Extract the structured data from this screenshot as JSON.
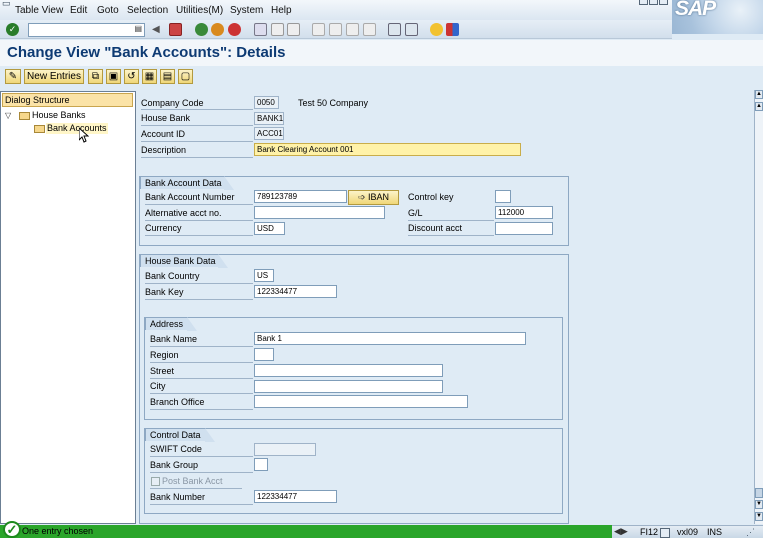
{
  "menu": {
    "table_view": "Table View",
    "edit": "Edit",
    "goto": "Goto",
    "selection": "Selection",
    "utilities": "Utilities(M)",
    "system": "System",
    "help": "Help"
  },
  "brand": {
    "logo": "SAP",
    "accent": "#0d3a73",
    "status_green": "#2aa52a",
    "highlight_yellow": "#fff2a8"
  },
  "command": {
    "value": ""
  },
  "page": {
    "title": "Change View \"Bank Accounts\": Details"
  },
  "toolbar2": {
    "new_entries": "New Entries"
  },
  "tree": {
    "header": "Dialog Structure",
    "node": "House Banks",
    "child": "Bank Accounts"
  },
  "fields": {
    "company_code_label": "Company Code",
    "company_code": "0050",
    "company_name": "Test 50 Company",
    "house_bank_label": "House Bank",
    "house_bank": "BANK1",
    "account_id_label": "Account ID",
    "account_id": "ACC01",
    "description_label": "Description",
    "description": "Bank Clearing Account 001"
  },
  "bank_account_data": {
    "title": "Bank Account Data",
    "account_number_label": "Bank Account Number",
    "account_number": "789123789",
    "iban_label": "IBAN",
    "control_key_label": "Control key",
    "control_key": "",
    "alt_acct_label": "Alternative acct no.",
    "alt_acct": "",
    "gl_label": "G/L",
    "gl": "112000",
    "currency_label": "Currency",
    "currency": "USD",
    "discount_label": "Discount acct",
    "discount": ""
  },
  "house_bank_data": {
    "title": "House Bank Data",
    "country_label": "Bank Country",
    "country": "US",
    "bank_key_label": "Bank Key",
    "bank_key": "122334477"
  },
  "address": {
    "title": "Address",
    "bank_name_label": "Bank Name",
    "bank_name": "Bank 1",
    "region_label": "Region",
    "region": "",
    "street_label": "Street",
    "street": "",
    "city_label": "City",
    "city": "",
    "branch_label": "Branch Office",
    "branch": ""
  },
  "control_data": {
    "title": "Control Data",
    "swift_label": "SWIFT Code",
    "swift": "",
    "bank_group_label": "Bank Group",
    "bank_group": "",
    "post_bank_label": "Post Bank Acct",
    "bank_number_label": "Bank Number",
    "bank_number": "122334477"
  },
  "status": {
    "message": "One entry chosen",
    "transaction": "FI12",
    "server": "vxl09",
    "mode": "INS"
  },
  "icons": [
    "enter-icon",
    "back-icon",
    "exit-icon",
    "cancel-icon",
    "save-icon",
    "print-icon",
    "find-icon",
    "help-icon",
    "layout-icon",
    "copy-icon",
    "delete-icon"
  ]
}
